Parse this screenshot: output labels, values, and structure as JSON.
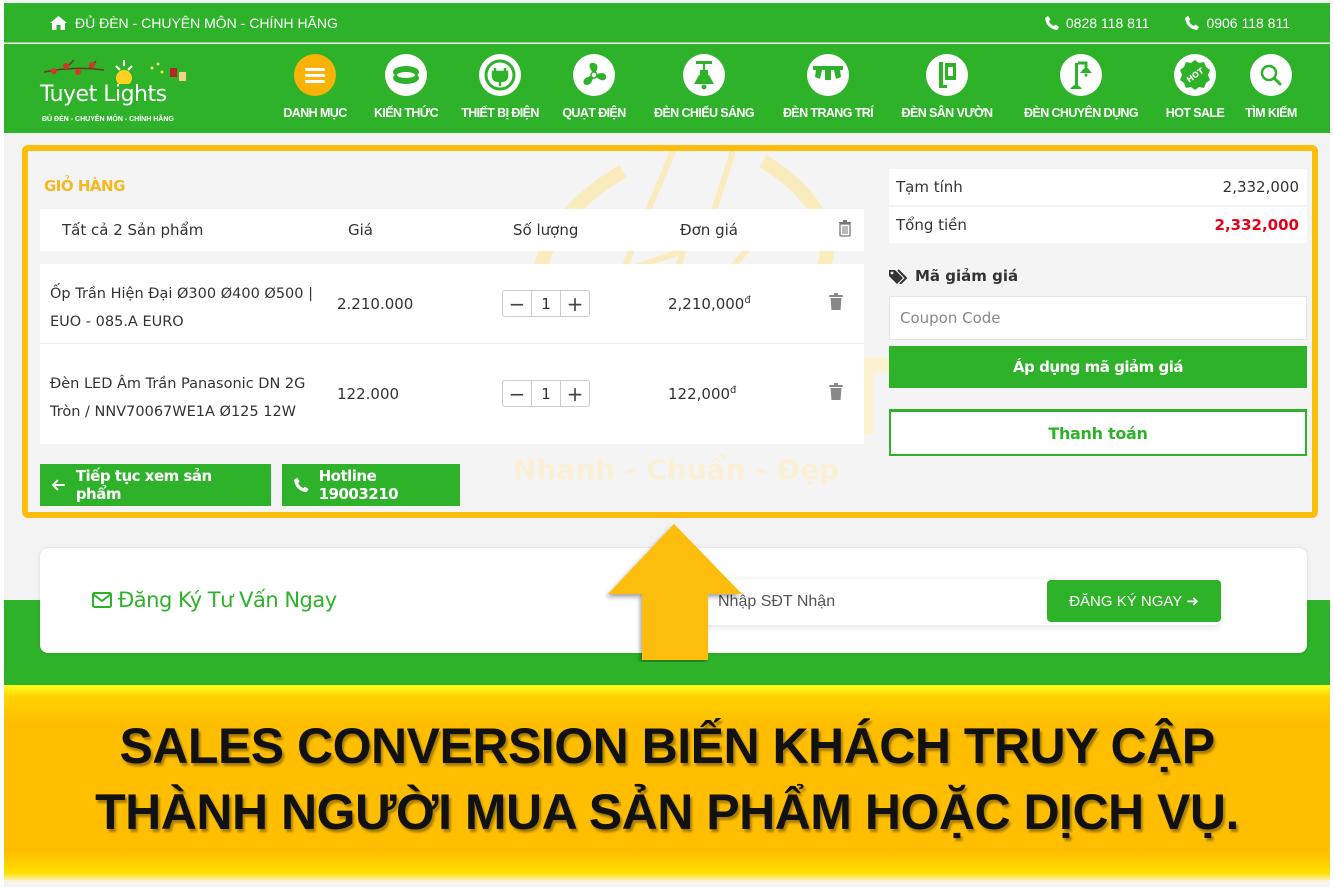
{
  "topbar": {
    "slogan": "ĐỦ ĐÈN - CHUYÊN MÔN - CHÍNH HÃNG",
    "phones": [
      "0828 118 811",
      "0906 118 811"
    ]
  },
  "logo": {
    "brand": "Tuyet Lights",
    "tagline": "ĐỦ ĐÈN - CHUYÊN MÔN - CHÍNH HÃNG"
  },
  "nav": {
    "items": [
      {
        "label": "DANH MỤC",
        "icon": "menu-icon"
      },
      {
        "label": "KIẾN THỨC",
        "icon": "ceiling-light-icon"
      },
      {
        "label": "THIẾT BỊ ĐIỆN",
        "icon": "plug-icon"
      },
      {
        "label": "QUẠT ĐIỆN",
        "icon": "fan-icon"
      },
      {
        "label": "ĐÈN CHIẾU SÁNG",
        "icon": "pendant-lamp-icon"
      },
      {
        "label": "ĐÈN TRANG TRÍ",
        "icon": "track-light-icon"
      },
      {
        "label": "ĐÈN SÂN VƯỜN",
        "icon": "garden-light-icon"
      },
      {
        "label": "ĐÈN CHUYÊN DỤNG",
        "icon": "street-lamp-icon"
      },
      {
        "label": "HOT SALE",
        "icon": "hot-badge-icon"
      },
      {
        "label": "TÌM KIẾM",
        "icon": "search-icon"
      }
    ]
  },
  "cart": {
    "title": "GIỎ HÀNG",
    "headers": {
      "product": "Tất cả 2 Sản phẩm",
      "price": "Giá",
      "quantity": "Số lượng",
      "unit_price": "Đơn giá"
    },
    "items": [
      {
        "name": "Ốp Trần Hiện Đại Ø300  Ø400 Ø500 | EUO - 085.A EURO",
        "price": "2.210.000",
        "quantity": "1",
        "unit_price": "2,210,000",
        "currency": "đ"
      },
      {
        "name": "Đèn LED Âm Trần Panasonic DN 2G Tròn / NNV70067WE1A Ø125 12W",
        "price": "122.000",
        "quantity": "1",
        "unit_price": "122,000",
        "currency": "đ"
      }
    ],
    "continue_label": "Tiếp tục xem sản phẩm",
    "hotline_label": "Hotline  19003210",
    "watermark": {
      "word": "LIGHT",
      "tagline": "Nhanh - Chuẩn - Đẹp"
    }
  },
  "summary": {
    "subtotal_label": "Tạm tính",
    "subtotal_value": "2,332,000",
    "total_label": "Tổng tiền",
    "total_value": "2,332,000",
    "total_color": "#e5001a",
    "coupon_title": "Mã giảm giá",
    "coupon_placeholder": "Coupon Code",
    "coupon_value": "",
    "apply_label": "Áp dụng mã giảm giá",
    "checkout_label": "Thanh toán"
  },
  "subscribe": {
    "title": "Đăng Ký Tư Vấn Ngay",
    "phone_placeholder": "Nhập SĐT Nhận",
    "button_label": "ĐĂNG KÝ NGAY ➜"
  },
  "banner": {
    "line1": "SALES CONVERSION BIẾN KHÁCH TRUY CẬP",
    "line2": "THÀNH NGƯỜI MUA SẢN PHẨM HOẶC DỊCH VỤ."
  },
  "colors": {
    "brand_green": "#2eb22a",
    "highlight_yellow": "#fdbd0c",
    "accent_orange": "#f9b208",
    "price_red": "#e5001a"
  }
}
